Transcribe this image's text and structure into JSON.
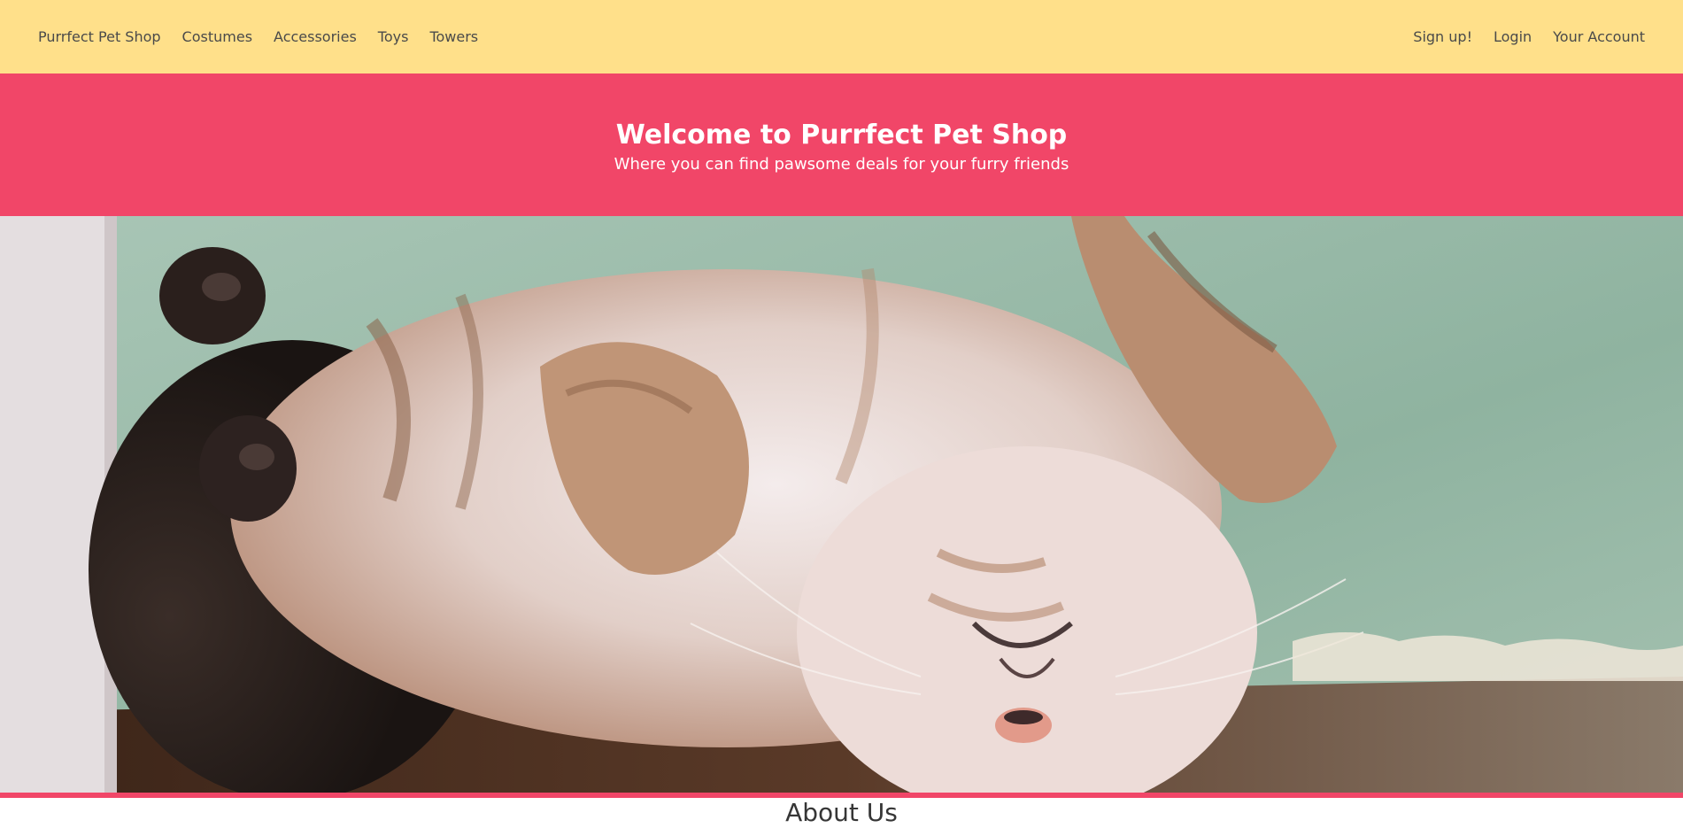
{
  "nav": {
    "brand": "Purrfect Pet Shop",
    "left_links": [
      "Costumes",
      "Accessories",
      "Toys",
      "Towers"
    ],
    "right_links": [
      "Sign up!",
      "Login",
      "Your Account"
    ]
  },
  "hero": {
    "title": "Welcome to Purrfect Pet Shop",
    "subtitle": "Where you can find pawsome deals for your furry friends"
  },
  "banner": {
    "image": "sleeping-cat-photo"
  },
  "about": {
    "heading": "About Us"
  },
  "colors": {
    "navbar": "#ffe08a",
    "hero": "#f14668",
    "hero_text": "#ffffff",
    "nav_text": "#4a4a4a"
  }
}
